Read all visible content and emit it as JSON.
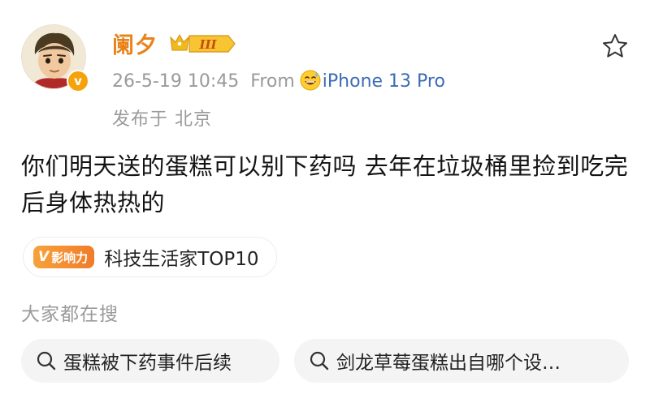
{
  "user": {
    "name": "阑夕",
    "level_badge": "III"
  },
  "meta": {
    "date_time": "26-5-19 10:45",
    "from_label": "From",
    "device": "iPhone 13 Pro",
    "location": "发布于 北京"
  },
  "post": {
    "text": "你们明天送的蛋糕可以别下药吗 去年在垃圾桶里捡到吃完后身体热热的"
  },
  "influence": {
    "badge_v": "V",
    "badge_label": "影响力",
    "text": "科技生活家TOP10"
  },
  "trending": {
    "title": "大家都在搜",
    "items": [
      {
        "label": "蛋糕被下药事件后续"
      },
      {
        "label": "剑龙草莓蛋糕出自哪个设…"
      }
    ]
  },
  "icons": {
    "favorite": "star-outline-icon",
    "search": "search-icon",
    "verified": "verified-icon",
    "emoji": "grinning-sweat-emoji-icon"
  },
  "colors": {
    "username": "#e8831a",
    "device_link": "#3d6cb4",
    "muted_text": "#9a9a9a",
    "influence_orange": "#f28a2e",
    "pill_bg": "#f4f4f4"
  }
}
